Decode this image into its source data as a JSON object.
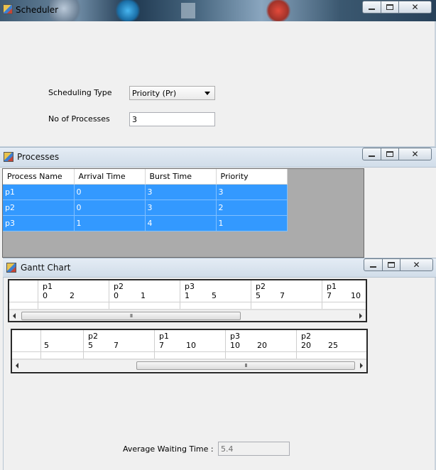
{
  "main_window": {
    "title": "Scheduler",
    "scheduling_type_label": "Scheduling Type",
    "scheduling_type_value": "Priority (Pr)",
    "num_processes_label": "No of Processes",
    "num_processes_value": "3"
  },
  "processes_window": {
    "title": "Processes",
    "columns": [
      "Process Name",
      "Arrival Time",
      "Burst Time",
      "Priority"
    ],
    "rows": [
      [
        "p1",
        "0",
        "3",
        "3"
      ],
      [
        "p2",
        "0",
        "3",
        "2"
      ],
      [
        "p3",
        "1",
        "4",
        "1"
      ]
    ]
  },
  "gantt_window": {
    "title": "Gantt Chart",
    "chart1": {
      "cells": [
        {
          "name": "p1",
          "start": "0",
          "end": "2"
        },
        {
          "name": "p2",
          "start": "0",
          "end": "1"
        },
        {
          "name": "p3",
          "start": "1",
          "end": "5"
        },
        {
          "name": "p2",
          "start": "5",
          "end": "7"
        },
        {
          "name": "p1",
          "start": "7",
          "end": "10"
        }
      ],
      "scroll_grip": "III"
    },
    "chart2": {
      "first_cell_value": "5",
      "cells": [
        {
          "name": "p2",
          "start": "5",
          "end": "7"
        },
        {
          "name": "p1",
          "start": "7",
          "end": "10"
        },
        {
          "name": "p3",
          "start": "10",
          "end": "20"
        },
        {
          "name": "p2",
          "start": "20",
          "end": "25"
        }
      ],
      "scroll_grip": "III"
    },
    "avg_waiting_label": "Average Waiting Time :",
    "avg_waiting_value": "5.4"
  },
  "icons": {
    "minimize": "minimize-icon",
    "maximize": "maximize-icon",
    "close": "close-icon",
    "app": "app-icon"
  }
}
